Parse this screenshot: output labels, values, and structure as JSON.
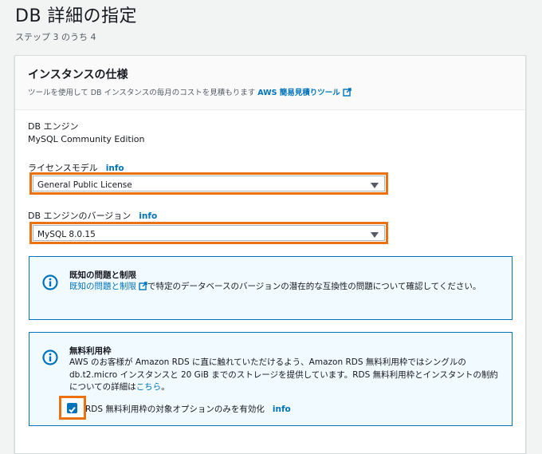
{
  "page": {
    "title": "DB 詳細の指定",
    "step": "ステップ 3 のうち 4"
  },
  "panel": {
    "title": "インスタンスの仕様",
    "desc": "ツールを使用して DB インスタンスの毎月のコストを見積もります",
    "desc_link": "AWS 簡易見積りツール"
  },
  "engine": {
    "label": "DB エンジン",
    "value": "MySQL Community Edition"
  },
  "license": {
    "label": "ライセンスモデル",
    "info": "info",
    "value": "General Public License"
  },
  "version": {
    "label": "DB エンジンのバージョン",
    "info": "info",
    "value": "MySQL 8.0.15"
  },
  "known_issues": {
    "title": "既知の問題と制限",
    "link": "既知の問題と制限",
    "body": "で特定のデータベースのバージョンの潜在的な互換性の問題について確認してください。"
  },
  "free_tier": {
    "title": "無料利用枠",
    "body": "AWS のお客様が Amazon RDS に直に触れていただけるよう、Amazon RDS 無料利用枠ではシングルの db.t2.micro インスタンスと 20 GiB までのストレージを提供しています。RDS 無料利用枠とインスタントの制約についての詳細は",
    "link": "こちら",
    "body_end": "。",
    "checkbox_label": "RDS 無料利用枠の対象オプションのみを有効化",
    "checkbox_checked": true,
    "info": "info"
  },
  "colors": {
    "accent_orange": "#ec7211",
    "link_blue": "#0073bb"
  }
}
